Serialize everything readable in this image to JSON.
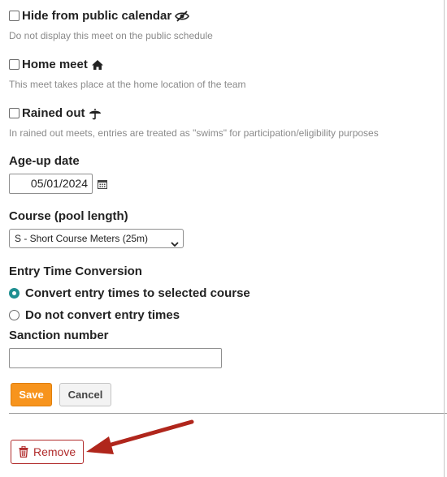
{
  "options": {
    "hide_public": {
      "label": "Hide from public calendar",
      "help": "Do not display this meet on the public schedule",
      "checked": false,
      "icon": "eye-slash-icon"
    },
    "home_meet": {
      "label": "Home meet",
      "help": "This meet takes place at the home location of the team",
      "checked": false,
      "icon": "home-icon"
    },
    "rained_out": {
      "label": "Rained out",
      "help": "In rained out meets, entries are treated as \"swims\" for participation/eligibility purposes",
      "checked": false,
      "icon": "umbrella-icon"
    }
  },
  "age_up": {
    "label": "Age-up date",
    "value": "05/01/2024",
    "icon": "calendar-icon"
  },
  "course": {
    "label": "Course (pool length)",
    "selected": "S - Short Course Meters (25m)"
  },
  "conversion": {
    "label": "Entry Time Conversion",
    "options": [
      {
        "label": "Convert entry times to selected course",
        "checked": true
      },
      {
        "label": "Do not convert entry times",
        "checked": false
      }
    ]
  },
  "sanction": {
    "label": "Sanction number",
    "value": ""
  },
  "buttons": {
    "save": "Save",
    "cancel": "Cancel",
    "remove": "Remove"
  },
  "colors": {
    "save_bg": "#f7941d",
    "remove_accent": "#b12c2c",
    "radio_accent": "#1f8f91",
    "annotation_arrow": "#b0261c"
  }
}
